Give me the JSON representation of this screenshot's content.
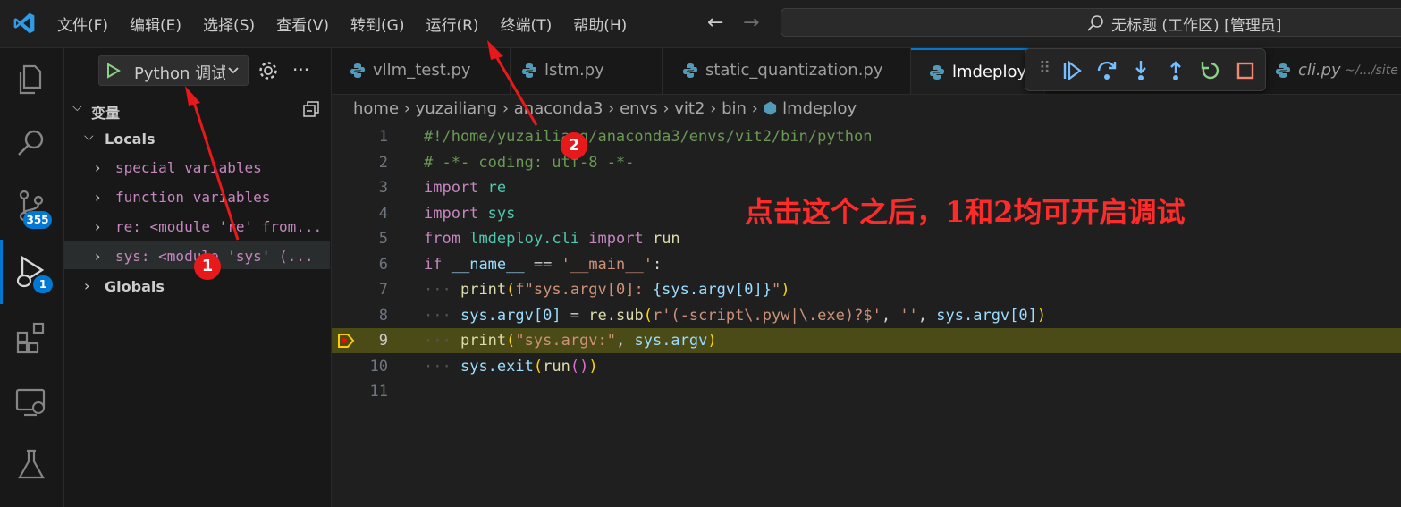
{
  "menu": [
    "文件(F)",
    "编辑(E)",
    "选择(S)",
    "查看(V)",
    "转到(G)",
    "运行(R)",
    "终端(T)",
    "帮助(H)"
  ],
  "command_center": "无标题 (工作区) [管理员]",
  "activity_badges": {
    "source_control": "355",
    "run_debug": "1"
  },
  "run_config": "Python 调试",
  "sidebar": {
    "section": "变量",
    "locals": "Locals",
    "items": [
      "special variables",
      "function variables",
      "re: <module 're' from...",
      "sys: <module 'sys' (..."
    ],
    "globals": "Globals"
  },
  "tabs": [
    {
      "label": "vllm_test.py"
    },
    {
      "label": "lstm.py"
    },
    {
      "label": "static_quantization.py"
    },
    {
      "label": "lmdeploy"
    },
    {
      "label": "cli.py"
    }
  ],
  "tab_path": "~/.../site",
  "breadcrumb": [
    "home",
    "yuzailiang",
    "anaconda3",
    "envs",
    "vit2",
    "bin",
    "lmdeploy"
  ],
  "line_numbers": [
    "1",
    "2",
    "3",
    "4",
    "5",
    "6",
    "7",
    "8",
    "9",
    "10",
    "11"
  ],
  "code": {
    "l1": "#!/home/yuzailiang/anaconda3/envs/vit2/bin/python",
    "l2": "# -*- coding: utf-8 -*-",
    "l3_kw": "import",
    "l3_mod": "re",
    "l4_kw": "import",
    "l4_mod": "sys",
    "l5_kw1": "from",
    "l5_mod": "lmdeploy.cli",
    "l5_kw2": "import",
    "l5_fn": "run",
    "l6_kw": "if",
    "l6_var": "__name__",
    "l6_op": "==",
    "l6_str": "'__main__'",
    "l6_end": ":",
    "l7_fn": "print",
    "l7_str1": "f\"sys.argv[0]: ",
    "l7_expr": "{sys.argv[0]}",
    "l7_str2": "\"",
    "l8_a": "sys.argv[0]",
    "l8_b": " = ",
    "l8_c": "re.sub",
    "l8_d": "r'(-script\\.pyw|\\.exe)?$'",
    "l8_e": ", ",
    "l8_f": "''",
    "l8_g": ", ",
    "l8_h": "sys.argv[0]",
    "l9_fn": "print",
    "l9_str": "\"sys.argv:\"",
    "l9_var": "sys.argv",
    "l10_a": "sys.exit",
    "l10_b": "run"
  },
  "annotation": "点击这个之后，1和2均可开启调试",
  "markers": [
    "1",
    "2"
  ]
}
